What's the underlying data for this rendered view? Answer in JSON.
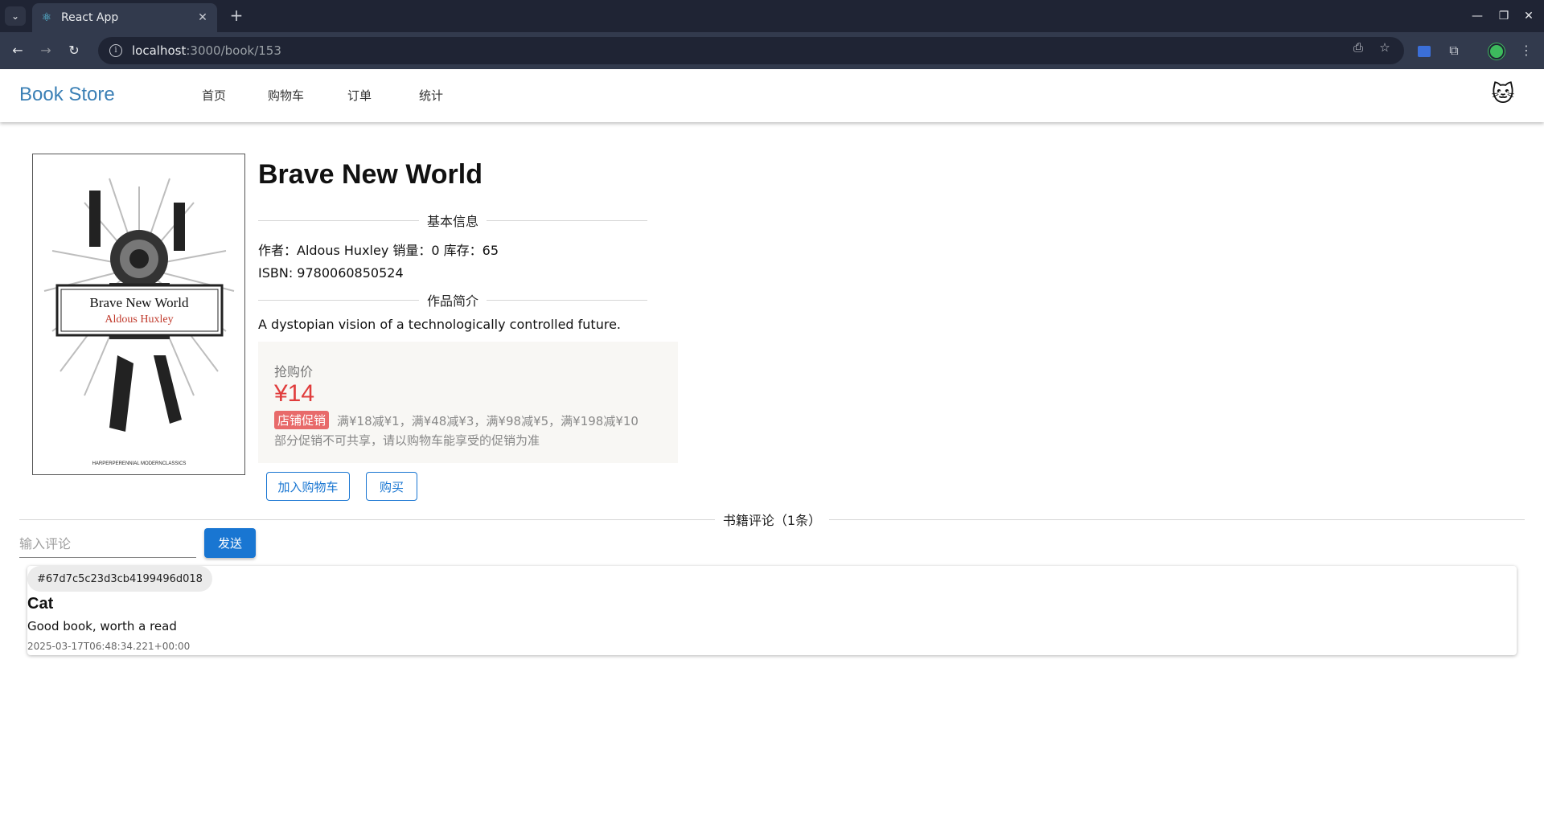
{
  "browser": {
    "tab_title": "React App",
    "url_host": "localhost",
    "url_path": ":3000/book/153"
  },
  "header": {
    "brand": "Book Store",
    "nav": [
      "首页",
      "购物车",
      "订单",
      "统计"
    ],
    "avatar_icon": "cat-face-icon"
  },
  "book": {
    "title": "Brave New World",
    "basic_info_label": "基本信息",
    "info_line": "作者：Aldous Huxley 销量：0 库存：65",
    "isbn_line": "ISBN: 9780060850524",
    "intro_label": "作品简介",
    "description": "A dystopian vision of a technologically controlled future.",
    "cover": {
      "title": "Brave New World",
      "author": "Aldous Huxley",
      "publisher": "HARPERPERENNIAL MODERNCLASSICS"
    }
  },
  "price": {
    "label": "抢购价",
    "value": "¥14",
    "promo_badge": "店铺促销",
    "promo_text": "满¥18减¥1，满¥48减¥3，满¥98减¥5，满¥198减¥10",
    "promo_note": "部分促销不可共享，请以购物车能享受的促销为准"
  },
  "actions": {
    "add_to_cart": "加入购物车",
    "buy": "购买"
  },
  "comments": {
    "section_label": "书籍评论（1条）",
    "input_placeholder": "输入评论",
    "send_label": "发送",
    "items": [
      {
        "id": "#67d7c5c23d3cb4199496d018",
        "user": "Cat",
        "text": "Good book, worth a read",
        "time": "2025-03-17T06:48:34.221+00:00"
      }
    ]
  },
  "colors": {
    "brand": "#3a7fb5",
    "primary": "#1976d2",
    "price": "#e03c3c",
    "promo_badge": "#e86a6a"
  }
}
